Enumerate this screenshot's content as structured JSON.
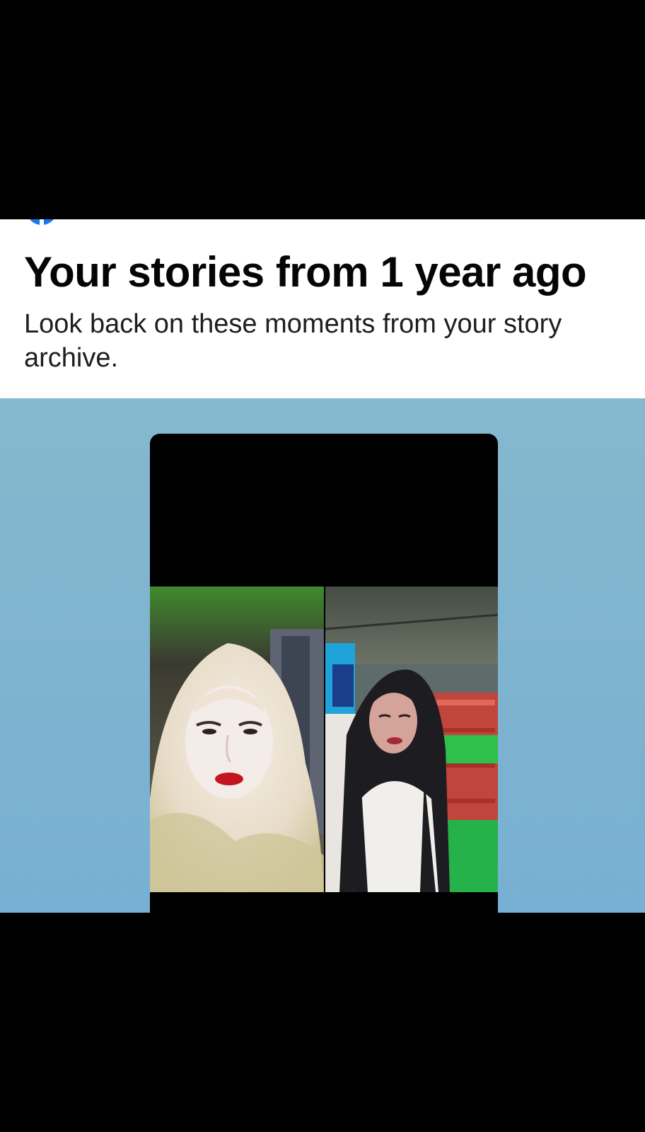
{
  "memory_card": {
    "title": "Your stories from 1 year ago",
    "subtitle": "Look back on these moments from your story archive.",
    "logo_icon": "facebook-logo-icon",
    "brand_color": "#1877f2",
    "hero_background": "#7fb4cf"
  },
  "story": {
    "thumbnail_icon": "story-video-thumbnail",
    "panels": [
      "woman-in-hijab-selfie",
      "woman-long-hair-selfie"
    ]
  }
}
